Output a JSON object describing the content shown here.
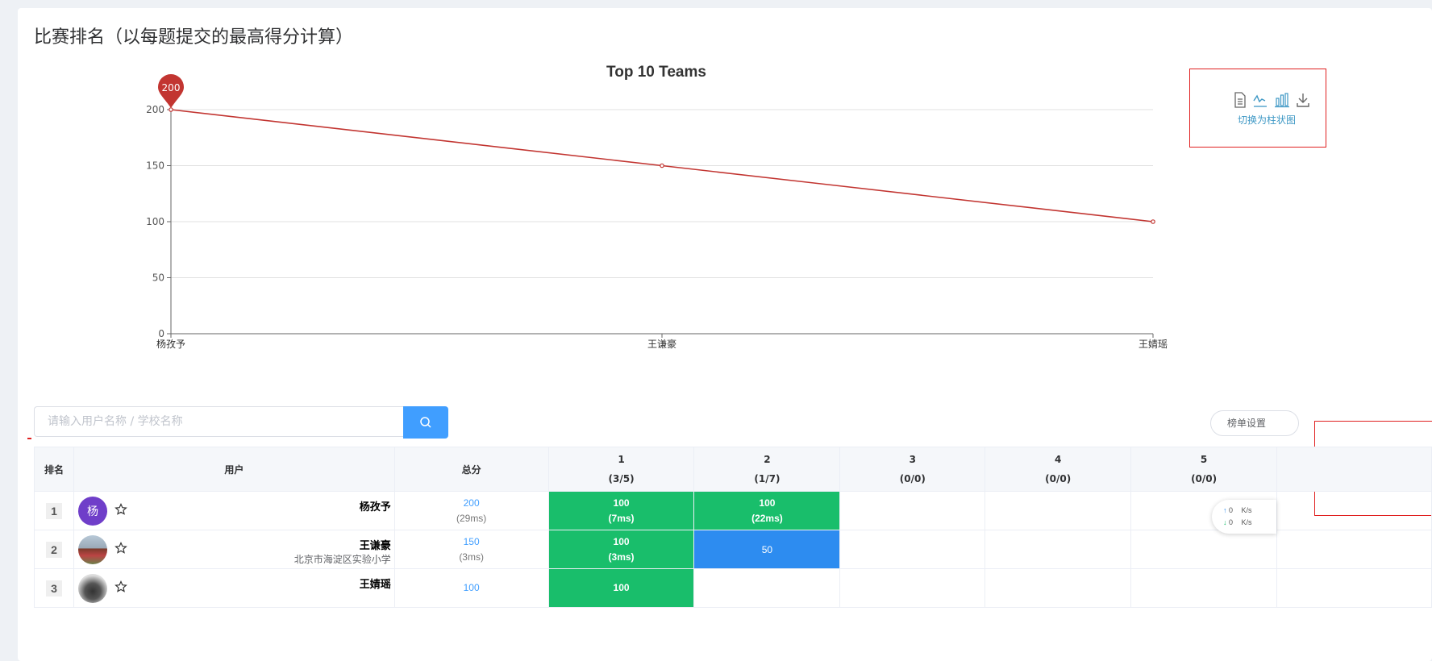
{
  "page": {
    "title": "比赛排名（以每题提交的最高得分计算）"
  },
  "chart_data": {
    "type": "line",
    "title": "Top 10 Teams",
    "categories": [
      "杨孜予",
      "王谦豪",
      "王婧瑶"
    ],
    "series": [
      {
        "values": [
          200,
          150,
          100
        ],
        "color": "#c23531"
      }
    ],
    "ylim": [
      0,
      200
    ],
    "yticks": [
      0,
      50,
      100,
      150,
      200
    ],
    "grid": true,
    "markpoint": {
      "label": "200",
      "category": "杨孜予"
    }
  },
  "toolbox": {
    "icons": [
      "data-view-icon",
      "line-chart-icon",
      "bar-chart-icon",
      "download-icon"
    ],
    "hint": "切换为柱状图",
    "accent": "#3e98c5"
  },
  "search": {
    "placeholder": "请输入用户名称 / 学校名称"
  },
  "settings": {
    "label": "榜单设置"
  },
  "table": {
    "headers": {
      "rank": "排名",
      "user": "用户",
      "total": "总分"
    },
    "problems": [
      {
        "id": "1",
        "stat": "(3/5)"
      },
      {
        "id": "2",
        "stat": "(1/7)"
      },
      {
        "id": "3",
        "stat": "(0/0)"
      },
      {
        "id": "4",
        "stat": "(0/0)"
      },
      {
        "id": "5",
        "stat": "(0/0)"
      }
    ],
    "rows": [
      {
        "rank": "1",
        "avatar_text": "杨",
        "name": "杨孜予",
        "school": "",
        "total": "200",
        "time": "(29ms)",
        "cells": [
          {
            "score": "100",
            "time": "(7ms)",
            "status": "ac"
          },
          {
            "score": "100",
            "time": "(22ms)",
            "status": "ac"
          },
          {
            "score": "",
            "time": "",
            "status": "none"
          },
          {
            "score": "",
            "time": "",
            "status": "none"
          },
          {
            "score": "",
            "time": "",
            "status": "none"
          }
        ]
      },
      {
        "rank": "2",
        "avatar_text": "",
        "name": "王谦豪",
        "school": "北京市海淀区实验小学",
        "total": "150",
        "time": "(3ms)",
        "cells": [
          {
            "score": "100",
            "time": "(3ms)",
            "status": "ac"
          },
          {
            "score": "50",
            "time": "",
            "status": "partial"
          },
          {
            "score": "",
            "time": "",
            "status": "none"
          },
          {
            "score": "",
            "time": "",
            "status": "none"
          },
          {
            "score": "",
            "time": "",
            "status": "none"
          }
        ]
      },
      {
        "rank": "3",
        "avatar_text": "",
        "name": "王婧瑶",
        "school": "",
        "total": "100",
        "time": "",
        "cells": [
          {
            "score": "100",
            "time": "",
            "status": "ac"
          },
          {
            "score": "",
            "time": "",
            "status": "none"
          },
          {
            "score": "",
            "time": "",
            "status": "none"
          },
          {
            "score": "",
            "time": "",
            "status": "none"
          },
          {
            "score": "",
            "time": "",
            "status": "none"
          }
        ]
      }
    ]
  },
  "network": {
    "up": "0",
    "down": "0",
    "unit": "K/s"
  }
}
